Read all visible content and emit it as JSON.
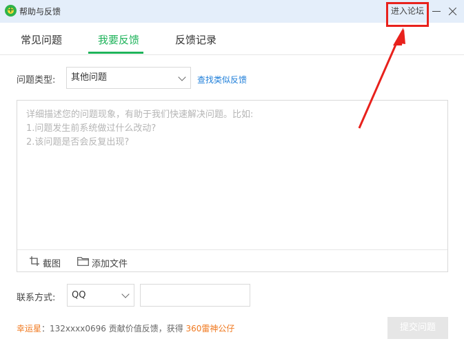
{
  "window": {
    "title": "帮助与反馈",
    "forum_link": "进入论坛"
  },
  "tabs": [
    {
      "label": "常见问题",
      "active": false
    },
    {
      "label": "我要反馈",
      "active": true
    },
    {
      "label": "反馈记录",
      "active": false
    }
  ],
  "form": {
    "problem_type_label": "问题类型:",
    "problem_type_value": "其他问题",
    "find_similar_link": "查找类似反馈",
    "description_placeholder_lines": [
      "详细描述您的问题现象，有助于我们快速解决问题。比如:",
      "1.问题发生前系统做过什么改动?",
      "2.该问题是否会反复出现?"
    ],
    "screenshot_label": "截图",
    "add_file_label": "添加文件",
    "contact_label": "联系方式:",
    "contact_type_value": "QQ",
    "contact_value": ""
  },
  "footer": {
    "lucky_label": "幸运星",
    "separator": "：",
    "lucky_text": "132xxxx0696 贡献价值反馈，获得",
    "prize": "360雷神公仔",
    "submit_label": "提交问题"
  },
  "colors": {
    "accent_green": "#1eb35a",
    "link_blue": "#1e7ed9",
    "highlight_red": "#e8211c",
    "orange": "#f0781e"
  },
  "icons": [
    "app-logo-icon",
    "minimize-icon",
    "close-icon",
    "chevron-down-icon",
    "crop-icon",
    "folder-icon"
  ]
}
